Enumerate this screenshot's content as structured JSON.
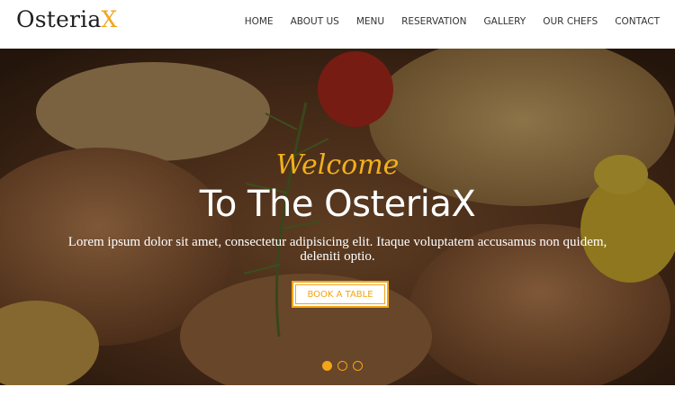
{
  "logo": {
    "main": "Osteria",
    "accent": "X"
  },
  "nav": [
    {
      "label": "HOME"
    },
    {
      "label": "ABOUT US"
    },
    {
      "label": "MENU"
    },
    {
      "label": "RESERVATION"
    },
    {
      "label": "GALLERY"
    },
    {
      "label": "OUR CHEFS"
    },
    {
      "label": "CONTACT"
    }
  ],
  "hero": {
    "welcome": "Welcome",
    "title": "To The OsteriaX",
    "text": "Lorem ipsum dolor sit amet, consectetur adipisicing elit. Itaque voluptatem accusamus non quidem, deleniti optio.",
    "button_label": "BOOK A TABLE",
    "slides": 3,
    "active_slide": 1
  },
  "colors": {
    "accent": "#f2a516",
    "text_dark": "#333333",
    "white": "#ffffff"
  }
}
